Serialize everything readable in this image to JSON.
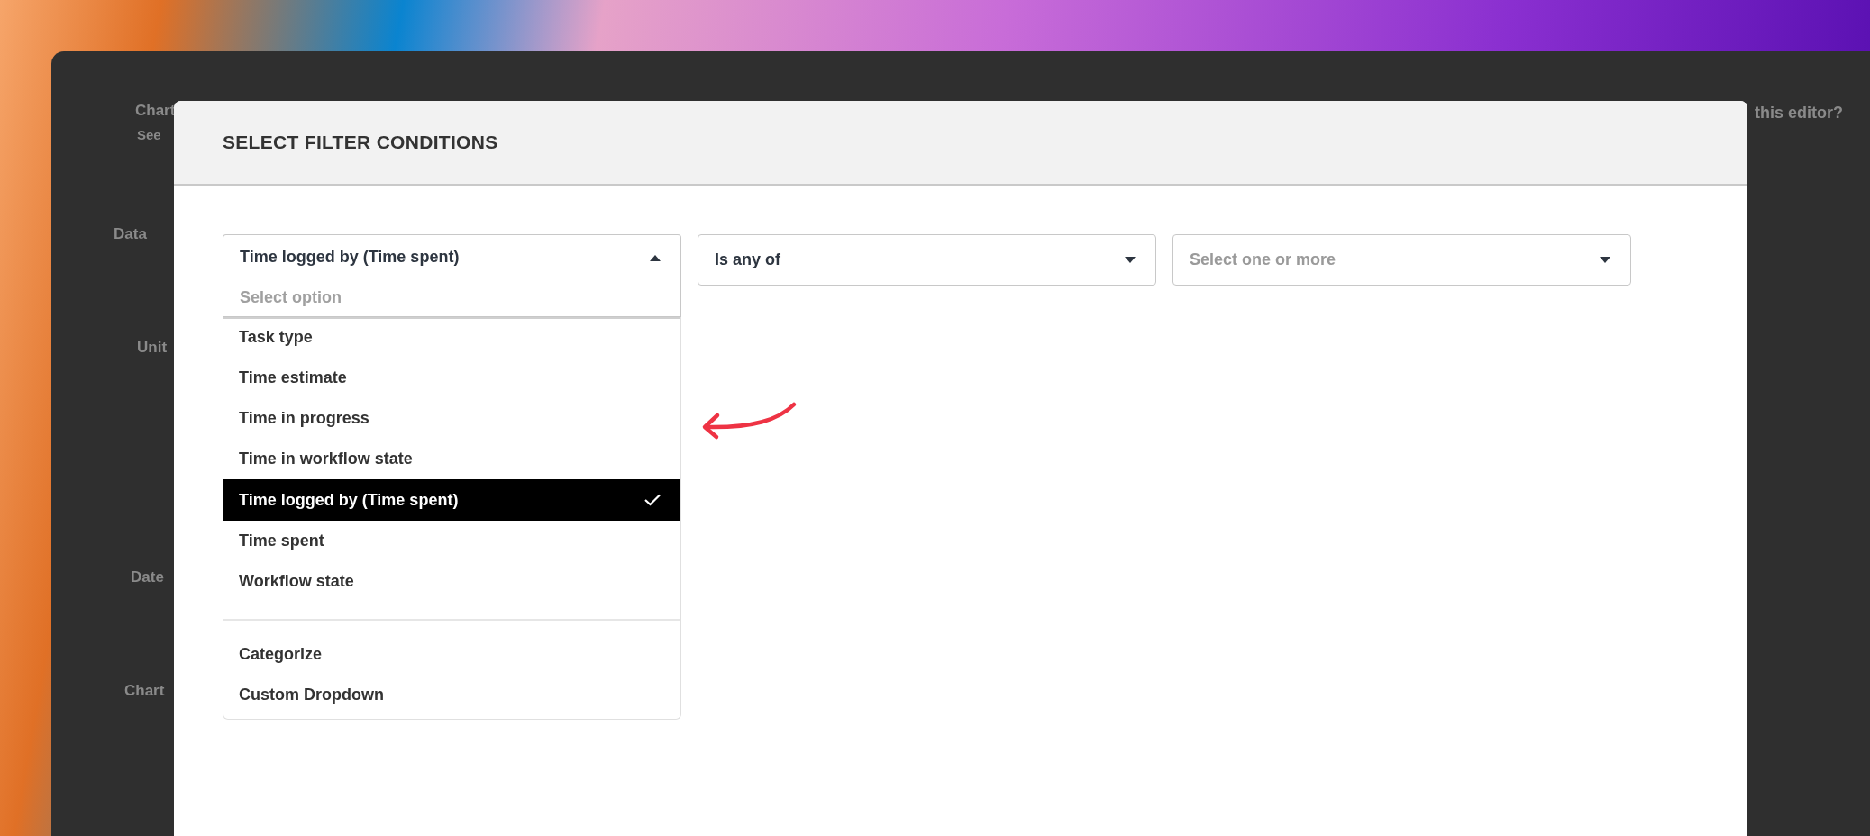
{
  "background": {
    "labels": [
      {
        "text": "Chart",
        "kind": "heading"
      },
      {
        "text": "See",
        "kind": "note"
      },
      {
        "text": "Data",
        "kind": "heading"
      },
      {
        "text": "Unit",
        "kind": "heading"
      },
      {
        "text": "Date",
        "kind": "heading"
      },
      {
        "text": "Chart",
        "kind": "heading"
      }
    ],
    "help_link": "this editor?"
  },
  "dialog": {
    "title": "SELECT FILTER CONDITIONS",
    "filters": [
      {
        "value": "Time logged by (Time spent)",
        "expanded": true,
        "search_placeholder": "Select option"
      },
      {
        "value": "Is any of",
        "expanded": false
      },
      {
        "placeholder": "Select one or more",
        "expanded": false
      }
    ],
    "option_groups": [
      {
        "options": [
          {
            "label": "Task type",
            "selected": false
          },
          {
            "label": "Time estimate",
            "selected": false
          },
          {
            "label": "Time in progress",
            "selected": false
          },
          {
            "label": "Time in workflow state",
            "selected": false
          },
          {
            "label": "Time logged by (Time spent)",
            "selected": true
          },
          {
            "label": "Time spent",
            "selected": false
          },
          {
            "label": "Workflow state",
            "selected": false
          }
        ]
      },
      {
        "options": [
          {
            "label": "Categorize",
            "selected": false
          },
          {
            "label": "Custom Dropdown",
            "selected": false
          }
        ]
      }
    ]
  }
}
